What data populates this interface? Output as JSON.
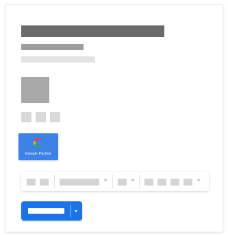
{
  "badge": {
    "logo_icon": "google-g-icon",
    "text": "Google Partner"
  },
  "colors": {
    "badge_background": "#3d82e8",
    "primary_button": "#1a73e8",
    "placeholder_dark": "#6b6b6b",
    "placeholder_mid": "#9e9e9e",
    "placeholder_light": "#e3e3e3"
  },
  "toolbar": {
    "caret_icon": "chevron-down-icon"
  },
  "primary_action": {
    "dropdown_icon": "caret-down-icon"
  }
}
